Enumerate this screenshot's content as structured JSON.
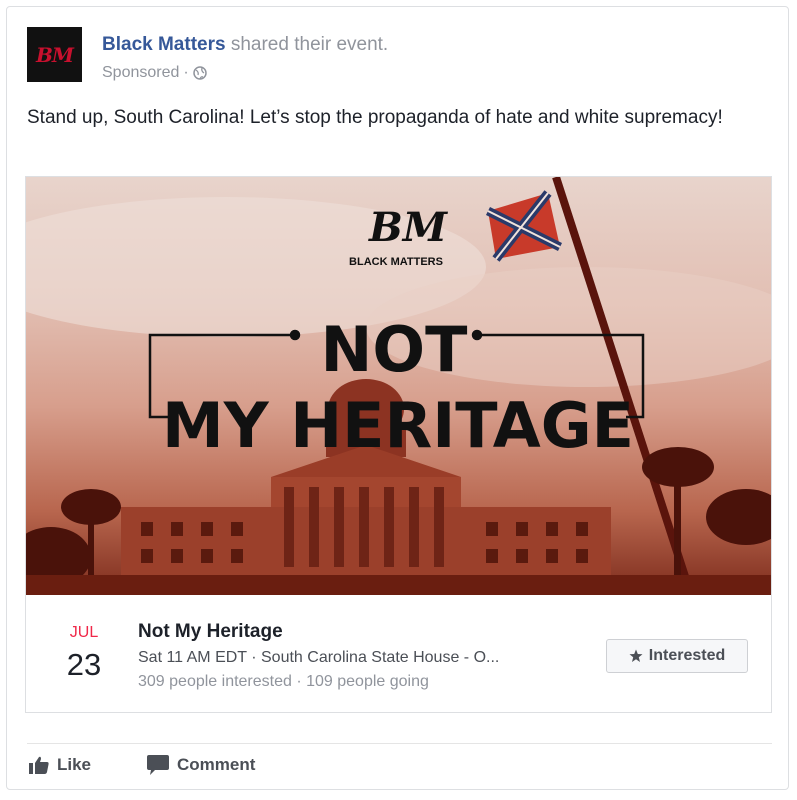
{
  "post": {
    "avatar_text": "BM",
    "page_name": "Black Matters",
    "action_text": "shared their event.",
    "sponsored_label": "Sponsored",
    "separator": "·",
    "text": "Stand up, South Carolina! Let’s stop the propaganda of hate and white supremacy!"
  },
  "banner": {
    "logo_mark": "BM",
    "logo_text": "BLACK MATTERS",
    "headline_top": "NOT",
    "headline_bottom": "MY HERITAGE"
  },
  "event": {
    "month": "JUL",
    "day": "23",
    "title": "Not My Heritage",
    "details": "Sat 11 AM EDT · South Carolina State House - O...",
    "stats": "309 people interested · 109 people going",
    "interested_label": "Interested"
  },
  "actions": {
    "like": "Like",
    "comment": "Comment"
  },
  "colors": {
    "page_name": "#365899",
    "month": "#f02849",
    "secondary_text": "#90949c"
  }
}
